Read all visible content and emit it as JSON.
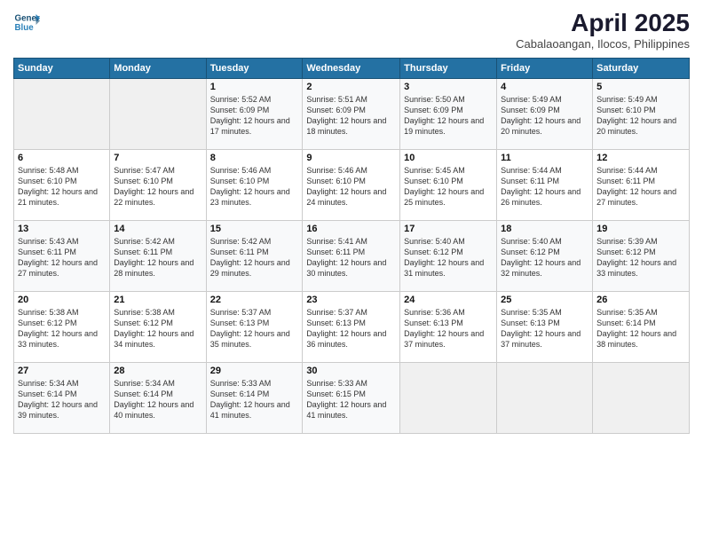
{
  "header": {
    "logo_line1": "General",
    "logo_line2": "Blue",
    "title": "April 2025",
    "subtitle": "Cabalaoangan, Ilocos, Philippines"
  },
  "weekdays": [
    "Sunday",
    "Monday",
    "Tuesday",
    "Wednesday",
    "Thursday",
    "Friday",
    "Saturday"
  ],
  "weeks": [
    [
      {
        "day": "",
        "info": ""
      },
      {
        "day": "",
        "info": ""
      },
      {
        "day": "1",
        "info": "Sunrise: 5:52 AM\nSunset: 6:09 PM\nDaylight: 12 hours and 17 minutes."
      },
      {
        "day": "2",
        "info": "Sunrise: 5:51 AM\nSunset: 6:09 PM\nDaylight: 12 hours and 18 minutes."
      },
      {
        "day": "3",
        "info": "Sunrise: 5:50 AM\nSunset: 6:09 PM\nDaylight: 12 hours and 19 minutes."
      },
      {
        "day": "4",
        "info": "Sunrise: 5:49 AM\nSunset: 6:09 PM\nDaylight: 12 hours and 20 minutes."
      },
      {
        "day": "5",
        "info": "Sunrise: 5:49 AM\nSunset: 6:10 PM\nDaylight: 12 hours and 20 minutes."
      }
    ],
    [
      {
        "day": "6",
        "info": "Sunrise: 5:48 AM\nSunset: 6:10 PM\nDaylight: 12 hours and 21 minutes."
      },
      {
        "day": "7",
        "info": "Sunrise: 5:47 AM\nSunset: 6:10 PM\nDaylight: 12 hours and 22 minutes."
      },
      {
        "day": "8",
        "info": "Sunrise: 5:46 AM\nSunset: 6:10 PM\nDaylight: 12 hours and 23 minutes."
      },
      {
        "day": "9",
        "info": "Sunrise: 5:46 AM\nSunset: 6:10 PM\nDaylight: 12 hours and 24 minutes."
      },
      {
        "day": "10",
        "info": "Sunrise: 5:45 AM\nSunset: 6:10 PM\nDaylight: 12 hours and 25 minutes."
      },
      {
        "day": "11",
        "info": "Sunrise: 5:44 AM\nSunset: 6:11 PM\nDaylight: 12 hours and 26 minutes."
      },
      {
        "day": "12",
        "info": "Sunrise: 5:44 AM\nSunset: 6:11 PM\nDaylight: 12 hours and 27 minutes."
      }
    ],
    [
      {
        "day": "13",
        "info": "Sunrise: 5:43 AM\nSunset: 6:11 PM\nDaylight: 12 hours and 27 minutes."
      },
      {
        "day": "14",
        "info": "Sunrise: 5:42 AM\nSunset: 6:11 PM\nDaylight: 12 hours and 28 minutes."
      },
      {
        "day": "15",
        "info": "Sunrise: 5:42 AM\nSunset: 6:11 PM\nDaylight: 12 hours and 29 minutes."
      },
      {
        "day": "16",
        "info": "Sunrise: 5:41 AM\nSunset: 6:11 PM\nDaylight: 12 hours and 30 minutes."
      },
      {
        "day": "17",
        "info": "Sunrise: 5:40 AM\nSunset: 6:12 PM\nDaylight: 12 hours and 31 minutes."
      },
      {
        "day": "18",
        "info": "Sunrise: 5:40 AM\nSunset: 6:12 PM\nDaylight: 12 hours and 32 minutes."
      },
      {
        "day": "19",
        "info": "Sunrise: 5:39 AM\nSunset: 6:12 PM\nDaylight: 12 hours and 33 minutes."
      }
    ],
    [
      {
        "day": "20",
        "info": "Sunrise: 5:38 AM\nSunset: 6:12 PM\nDaylight: 12 hours and 33 minutes."
      },
      {
        "day": "21",
        "info": "Sunrise: 5:38 AM\nSunset: 6:12 PM\nDaylight: 12 hours and 34 minutes."
      },
      {
        "day": "22",
        "info": "Sunrise: 5:37 AM\nSunset: 6:13 PM\nDaylight: 12 hours and 35 minutes."
      },
      {
        "day": "23",
        "info": "Sunrise: 5:37 AM\nSunset: 6:13 PM\nDaylight: 12 hours and 36 minutes."
      },
      {
        "day": "24",
        "info": "Sunrise: 5:36 AM\nSunset: 6:13 PM\nDaylight: 12 hours and 37 minutes."
      },
      {
        "day": "25",
        "info": "Sunrise: 5:35 AM\nSunset: 6:13 PM\nDaylight: 12 hours and 37 minutes."
      },
      {
        "day": "26",
        "info": "Sunrise: 5:35 AM\nSunset: 6:14 PM\nDaylight: 12 hours and 38 minutes."
      }
    ],
    [
      {
        "day": "27",
        "info": "Sunrise: 5:34 AM\nSunset: 6:14 PM\nDaylight: 12 hours and 39 minutes."
      },
      {
        "day": "28",
        "info": "Sunrise: 5:34 AM\nSunset: 6:14 PM\nDaylight: 12 hours and 40 minutes."
      },
      {
        "day": "29",
        "info": "Sunrise: 5:33 AM\nSunset: 6:14 PM\nDaylight: 12 hours and 41 minutes."
      },
      {
        "day": "30",
        "info": "Sunrise: 5:33 AM\nSunset: 6:15 PM\nDaylight: 12 hours and 41 minutes."
      },
      {
        "day": "",
        "info": ""
      },
      {
        "day": "",
        "info": ""
      },
      {
        "day": "",
        "info": ""
      }
    ]
  ]
}
